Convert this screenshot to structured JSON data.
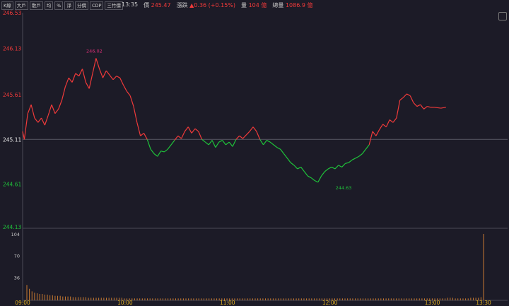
{
  "toolbar": {
    "tabs": [
      "K線",
      "大戶",
      "散戶",
      "均",
      "%",
      "淨",
      "分價",
      "CDP",
      "三竹價"
    ]
  },
  "header": {
    "time": "13:35",
    "price_label": "價",
    "price_value": "245.47",
    "change_label": "漲跌",
    "change_value": "▲0.36 (+0.15%)",
    "volume_label": "量",
    "volume_value": "104 億",
    "total_volume_label": "總量",
    "total_volume_value": "1086.9 億"
  },
  "colors": {
    "up": "#f03a3a",
    "down": "#1fc23a",
    "ref": "#e6e6e6",
    "volume": "#c87a30",
    "high_label": "#e0307a"
  },
  "chart_data": {
    "type": "line",
    "x_ticks": [
      "09:00",
      "10:00",
      "11:00",
      "12:00",
      "13:00",
      "13:30"
    ],
    "y_ticks": [
      "246.53",
      "246.13",
      "245.61",
      "245.11",
      "244.61",
      "244.13"
    ],
    "reference": 245.11,
    "ylim": [
      244.13,
      246.53
    ],
    "high": {
      "label": "246.02",
      "time": "09:42",
      "value": 246.02
    },
    "low": {
      "label": "244.63",
      "time": "12:08",
      "value": 244.63
    },
    "price_series": [
      [
        "09:00",
        245.2
      ],
      [
        "09:01",
        245.11
      ],
      [
        "09:03",
        245.4
      ],
      [
        "09:05",
        245.5
      ],
      [
        "09:07",
        245.35
      ],
      [
        "09:09",
        245.3
      ],
      [
        "09:11",
        245.35
      ],
      [
        "09:13",
        245.27
      ],
      [
        "09:15",
        245.38
      ],
      [
        "09:17",
        245.5
      ],
      [
        "09:19",
        245.4
      ],
      [
        "09:21",
        245.45
      ],
      [
        "09:23",
        245.55
      ],
      [
        "09:25",
        245.7
      ],
      [
        "09:27",
        245.8
      ],
      [
        "09:29",
        245.75
      ],
      [
        "09:31",
        245.85
      ],
      [
        "09:33",
        245.82
      ],
      [
        "09:35",
        245.9
      ],
      [
        "09:37",
        245.75
      ],
      [
        "09:39",
        245.68
      ],
      [
        "09:41",
        245.85
      ],
      [
        "09:43",
        246.02
      ],
      [
        "09:45",
        245.9
      ],
      [
        "09:47",
        245.8
      ],
      [
        "09:49",
        245.88
      ],
      [
        "09:51",
        245.83
      ],
      [
        "09:53",
        245.78
      ],
      [
        "09:55",
        245.82
      ],
      [
        "09:57",
        245.8
      ],
      [
        "09:59",
        245.72
      ],
      [
        "10:01",
        245.65
      ],
      [
        "10:03",
        245.6
      ],
      [
        "10:05",
        245.48
      ],
      [
        "10:07",
        245.3
      ],
      [
        "10:09",
        245.15
      ],
      [
        "10:11",
        245.18
      ],
      [
        "10:13",
        245.11
      ],
      [
        "10:15",
        245.0
      ],
      [
        "10:17",
        244.95
      ],
      [
        "10:19",
        244.92
      ],
      [
        "10:21",
        244.98
      ],
      [
        "10:23",
        244.97
      ],
      [
        "10:25",
        245.0
      ],
      [
        "10:27",
        245.05
      ],
      [
        "10:29",
        245.1
      ],
      [
        "10:31",
        245.15
      ],
      [
        "10:33",
        245.12
      ],
      [
        "10:35",
        245.2
      ],
      [
        "10:37",
        245.25
      ],
      [
        "10:39",
        245.18
      ],
      [
        "10:41",
        245.23
      ],
      [
        "10:43",
        245.2
      ],
      [
        "10:45",
        245.11
      ],
      [
        "10:47",
        245.08
      ],
      [
        "10:49",
        245.05
      ],
      [
        "10:51",
        245.1
      ],
      [
        "10:53",
        245.02
      ],
      [
        "10:55",
        245.08
      ],
      [
        "10:57",
        245.1
      ],
      [
        "10:59",
        245.05
      ],
      [
        "11:01",
        245.08
      ],
      [
        "11:03",
        245.03
      ],
      [
        "11:05",
        245.11
      ],
      [
        "11:07",
        245.15
      ],
      [
        "11:09",
        245.12
      ],
      [
        "11:11",
        245.16
      ],
      [
        "11:13",
        245.2
      ],
      [
        "11:15",
        245.25
      ],
      [
        "11:17",
        245.2
      ],
      [
        "11:19",
        245.11
      ],
      [
        "11:21",
        245.05
      ],
      [
        "11:23",
        245.1
      ],
      [
        "11:25",
        245.08
      ],
      [
        "11:27",
        245.05
      ],
      [
        "11:29",
        245.02
      ],
      [
        "11:31",
        245.0
      ],
      [
        "11:33",
        244.95
      ],
      [
        "11:35",
        244.9
      ],
      [
        "11:37",
        244.85
      ],
      [
        "11:39",
        244.82
      ],
      [
        "11:41",
        244.78
      ],
      [
        "11:43",
        244.8
      ],
      [
        "11:45",
        244.75
      ],
      [
        "11:47",
        244.7
      ],
      [
        "11:49",
        244.68
      ],
      [
        "11:51",
        244.65
      ],
      [
        "11:53",
        244.63
      ],
      [
        "11:55",
        244.7
      ],
      [
        "11:57",
        244.75
      ],
      [
        "11:59",
        244.78
      ],
      [
        "12:01",
        244.8
      ],
      [
        "12:03",
        244.78
      ],
      [
        "12:05",
        244.82
      ],
      [
        "12:07",
        244.8
      ],
      [
        "12:09",
        244.84
      ],
      [
        "12:11",
        244.85
      ],
      [
        "12:13",
        244.88
      ],
      [
        "12:15",
        244.9
      ],
      [
        "12:17",
        244.92
      ],
      [
        "12:19",
        244.95
      ],
      [
        "12:21",
        245.0
      ],
      [
        "12:23",
        245.05
      ],
      [
        "12:25",
        245.2
      ],
      [
        "12:27",
        245.15
      ],
      [
        "12:29",
        245.22
      ],
      [
        "12:31",
        245.28
      ],
      [
        "12:33",
        245.25
      ],
      [
        "12:35",
        245.33
      ],
      [
        "12:37",
        245.3
      ],
      [
        "12:39",
        245.35
      ],
      [
        "12:41",
        245.55
      ],
      [
        "12:43",
        245.58
      ],
      [
        "12:45",
        245.62
      ],
      [
        "12:47",
        245.6
      ],
      [
        "12:49",
        245.52
      ],
      [
        "12:51",
        245.48
      ],
      [
        "12:53",
        245.5
      ],
      [
        "12:55",
        245.45
      ],
      [
        "12:57",
        245.48
      ],
      [
        "12:59",
        245.47
      ],
      [
        "13:01",
        245.47
      ],
      [
        "13:05",
        245.46
      ],
      [
        "13:08",
        245.47
      ]
    ],
    "volume": {
      "y_ticks": [
        "104",
        "70",
        "36"
      ],
      "values": [
        24,
        18,
        14,
        12,
        11,
        10,
        10,
        9,
        9,
        8,
        8,
        7,
        7,
        7,
        6,
        6,
        6,
        6,
        5,
        5,
        5,
        5,
        5,
        5,
        4,
        4,
        4,
        4,
        4,
        4,
        4,
        4,
        4,
        4,
        4,
        4,
        4,
        4,
        3,
        3,
        3,
        3,
        3,
        3,
        3,
        3,
        3,
        3,
        3,
        3,
        3,
        3,
        3,
        3,
        3,
        3,
        3,
        3,
        3,
        3,
        3,
        3,
        3,
        3,
        3,
        3,
        3,
        3,
        3,
        3,
        3,
        3,
        3,
        3,
        3,
        3,
        3,
        3,
        3,
        3,
        3,
        3,
        3,
        3,
        3,
        3,
        3,
        3,
        3,
        3,
        3,
        3,
        3,
        3,
        3,
        3,
        3,
        3,
        3,
        3,
        3,
        3,
        3,
        3,
        3,
        3,
        3,
        3,
        3,
        3,
        3,
        3,
        3,
        3,
        3,
        3,
        3,
        3,
        3,
        3,
        3,
        3,
        3,
        3,
        3,
        3,
        3,
        3,
        3,
        3,
        3,
        3,
        3,
        3,
        3,
        3,
        3,
        3,
        3,
        3,
        3,
        3,
        3,
        3,
        3,
        3,
        3,
        3,
        3,
        3,
        3,
        3,
        3,
        3,
        3,
        3,
        3,
        3,
        3,
        3,
        3,
        3,
        3,
        3,
        4,
        4,
        4,
        3,
        3,
        3,
        3,
        3,
        3,
        4,
        4,
        4,
        4,
        5,
        104
      ],
      "ylim": [
        0,
        104
      ]
    }
  }
}
